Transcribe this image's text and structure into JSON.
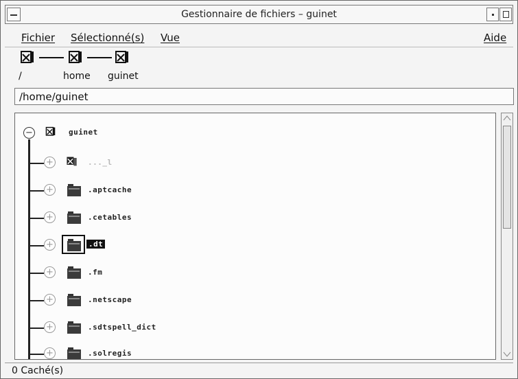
{
  "window": {
    "title": "Gestionnaire de fichiers – guinet"
  },
  "menubar": {
    "file": "Fichier",
    "selected": "Sélectionné(s)",
    "view": "Vue",
    "help": "Aide"
  },
  "breadcrumb": {
    "items": [
      "/",
      "home",
      "guinet"
    ]
  },
  "path_field": {
    "value": "/home/guinet"
  },
  "tree": {
    "root": "guinet",
    "items": [
      {
        "label": "..._l",
        "dimmed": true,
        "icon": "home-folder-icon",
        "selected": false
      },
      {
        "label": ".aptcache",
        "dimmed": false,
        "icon": "folder-icon",
        "selected": false
      },
      {
        "label": ".cetables",
        "dimmed": false,
        "icon": "folder-icon",
        "selected": false
      },
      {
        "label": ".dt",
        "dimmed": false,
        "icon": "folder-icon",
        "selected": true
      },
      {
        "label": ".fm",
        "dimmed": false,
        "icon": "folder-icon",
        "selected": false
      },
      {
        "label": ".netscape",
        "dimmed": false,
        "icon": "folder-icon",
        "selected": false
      },
      {
        "label": ".sdtspell_dict",
        "dimmed": false,
        "icon": "folder-icon",
        "selected": false
      },
      {
        "label": ".solregis",
        "dimmed": false,
        "icon": "folder-icon",
        "selected": false
      }
    ]
  },
  "status": {
    "text": "0 Caché(s)"
  }
}
